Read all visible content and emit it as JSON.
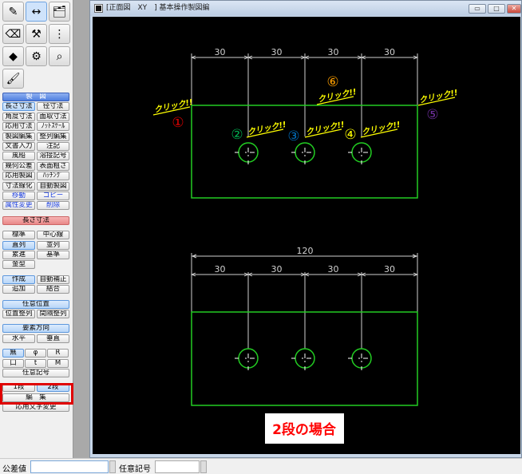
{
  "toolbar_icons": [
    "drawing-pen-icon",
    "dimension-icon",
    "folders-icon",
    "eraser-icon",
    "tools-icon",
    "tree-icon",
    "cube-icon",
    "toolbox-icon",
    "chart-search-icon",
    "paint-roller-icon"
  ],
  "panel": {
    "rows": [
      [
        {
          "label": "製　図",
          "style": "hdr",
          "span": 2
        }
      ],
      [
        {
          "label": "長さ寸法",
          "style": "act"
        },
        {
          "label": "径寸法"
        }
      ],
      [
        {
          "label": "角度寸法"
        },
        {
          "label": "面取寸法"
        }
      ],
      [
        {
          "label": "応用寸法"
        },
        {
          "label": "ﾉｯﾄｽｹｰﾙ"
        }
      ],
      [
        {
          "label": "製図編集"
        },
        {
          "label": "整列編集"
        }
      ],
      [
        {
          "label": "文書入力"
        },
        {
          "label": "注記"
        }
      ],
      [
        {
          "label": "風船"
        },
        {
          "label": "溶接記号"
        }
      ],
      [
        {
          "label": "幾何公差"
        },
        {
          "label": "表面粗さ"
        }
      ],
      [
        {
          "label": "応用製図"
        },
        {
          "label": "ﾊｯﾁﾝｸﾞ"
        }
      ],
      [
        {
          "label": "寸法線化"
        },
        {
          "label": "自動製図"
        }
      ],
      [
        {
          "label": "移動",
          "style": "blue"
        },
        {
          "label": "コピー",
          "style": "blue"
        }
      ],
      [
        {
          "label": "属性変更",
          "style": "blue"
        },
        {
          "label": "削除",
          "style": "blue"
        }
      ],
      [
        {
          "label": "長さ寸法",
          "style": "pink",
          "span": 2,
          "gap": true
        }
      ],
      [
        {
          "label": "標準",
          "gap": true
        },
        {
          "label": "中心線"
        }
      ],
      [
        {
          "label": "直列",
          "style": "act"
        },
        {
          "label": "並列"
        }
      ],
      [
        {
          "label": "累進"
        },
        {
          "label": "基準"
        }
      ],
      [
        {
          "label": "金型"
        }
      ],
      [
        {
          "label": "作成",
          "style": "act",
          "gap": true
        },
        {
          "label": "自動補正"
        }
      ],
      [
        {
          "label": "追加"
        },
        {
          "label": "結合"
        }
      ],
      [
        {
          "label": "任意位置",
          "style": "act",
          "span": 2,
          "gap": true
        }
      ],
      [
        {
          "label": "位置整列"
        },
        {
          "label": "間隔整列"
        }
      ],
      [
        {
          "label": "要素方向",
          "style": "act",
          "span": 2,
          "gap": true
        }
      ],
      [
        {
          "label": "水平"
        },
        {
          "label": "垂直"
        }
      ],
      [
        {
          "label": "無",
          "style": "act",
          "gap": true,
          "third": true
        },
        {
          "label": "φ",
          "third": true
        },
        {
          "label": "R",
          "third": true
        }
      ],
      [
        {
          "label": "口",
          "third": true
        },
        {
          "label": "t",
          "third": true
        },
        {
          "label": "M",
          "third": true
        }
      ],
      [
        {
          "label": "任意記号",
          "span": 2
        }
      ],
      [
        {
          "label": "1段",
          "gap": true
        },
        {
          "label": "2段",
          "style": "act"
        }
      ],
      [
        {
          "label": "編　集",
          "span": 2
        }
      ],
      [
        {
          "label": "応用文字変更",
          "span": 2
        }
      ]
    ]
  },
  "window": {
    "title": "[正面図　XY　] 基本操作製図編",
    "min": "▭",
    "max": "□",
    "close": "✕"
  },
  "drawing": {
    "dims_top": [
      "30",
      "30",
      "30",
      "30"
    ],
    "dim_total": "120",
    "dims_bottom": [
      "30",
      "30",
      "30",
      "30"
    ],
    "click_label": "クリック!!",
    "markers": [
      {
        "label": "①",
        "color": "#e00000"
      },
      {
        "label": "②",
        "color": "#00b050"
      },
      {
        "label": "③",
        "color": "#0070c0"
      },
      {
        "label": "④",
        "color": "#ffff00"
      },
      {
        "label": "⑤",
        "color": "#7030a0"
      },
      {
        "label": "⑥",
        "color": "#ffa000"
      }
    ],
    "caption": "2段の場合",
    "colors": {
      "outline": "#22cc22",
      "dimension": "#d0d0d0",
      "click": "#ffff00",
      "caption": "#ff0000"
    }
  },
  "status": {
    "tolerance_label": "公差値",
    "tolerance_value": "",
    "symbol_label": "任意記号",
    "symbol_value": ""
  }
}
